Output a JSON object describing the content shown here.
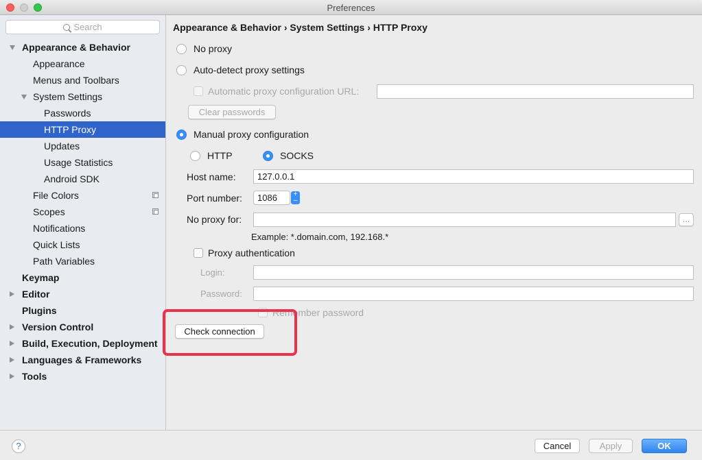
{
  "window": {
    "title": "Preferences"
  },
  "sidebar": {
    "search_placeholder": "Search",
    "items": [
      {
        "label": "Appearance & Behavior",
        "level": 0,
        "bold": true,
        "expander": "down"
      },
      {
        "label": "Appearance",
        "level": 1
      },
      {
        "label": "Menus and Toolbars",
        "level": 1
      },
      {
        "label": "System Settings",
        "level": 1,
        "expander": "down"
      },
      {
        "label": "Passwords",
        "level": 2
      },
      {
        "label": "HTTP Proxy",
        "level": 2,
        "selected": true
      },
      {
        "label": "Updates",
        "level": 2
      },
      {
        "label": "Usage Statistics",
        "level": 2
      },
      {
        "label": "Android SDK",
        "level": 2
      },
      {
        "label": "File Colors",
        "level": 1,
        "copy_icon": true
      },
      {
        "label": "Scopes",
        "level": 1,
        "copy_icon": true
      },
      {
        "label": "Notifications",
        "level": 1
      },
      {
        "label": "Quick Lists",
        "level": 1
      },
      {
        "label": "Path Variables",
        "level": 1
      },
      {
        "label": "Keymap",
        "level": 0,
        "bold": true
      },
      {
        "label": "Editor",
        "level": 0,
        "bold": true,
        "expander": "right"
      },
      {
        "label": "Plugins",
        "level": 0,
        "bold": true
      },
      {
        "label": "Version Control",
        "level": 0,
        "bold": true,
        "expander": "right"
      },
      {
        "label": "Build, Execution, Deployment",
        "level": 0,
        "bold": true,
        "expander": "right"
      },
      {
        "label": "Languages & Frameworks",
        "level": 0,
        "bold": true,
        "expander": "right"
      },
      {
        "label": "Tools",
        "level": 0,
        "bold": true,
        "expander": "right"
      }
    ]
  },
  "main": {
    "breadcrumb": "Appearance & Behavior › System Settings › HTTP Proxy",
    "no_proxy_label": "No proxy",
    "auto_detect_label": "Auto-detect proxy settings",
    "auto_config_url_label": "Automatic proxy configuration URL:",
    "auto_config_url_value": "",
    "clear_passwords_label": "Clear passwords",
    "manual_label": "Manual proxy configuration",
    "http_label": "HTTP",
    "socks_label": "SOCKS",
    "host_label": "Host name:",
    "host_value": "127.0.0.1",
    "port_label": "Port number:",
    "port_value": "1086",
    "no_proxy_for_label": "No proxy for:",
    "no_proxy_for_value": "",
    "browse_label": "...",
    "example_text": "Example: *.domain.com, 192.168.*",
    "proxy_auth_label": "Proxy authentication",
    "login_label": "Login:",
    "login_value": "",
    "password_label": "Password:",
    "password_value": "",
    "remember_label": "Remember password",
    "check_connection_label": "Check connection",
    "selected_mode": "manual",
    "selected_protocol": "SOCKS"
  },
  "footer": {
    "help_label": "?",
    "cancel_label": "Cancel",
    "apply_label": "Apply",
    "ok_label": "OK"
  },
  "colors": {
    "selection": "#2f65ca",
    "accent": "#3a8ff6",
    "highlight_box": "#e8334a"
  }
}
